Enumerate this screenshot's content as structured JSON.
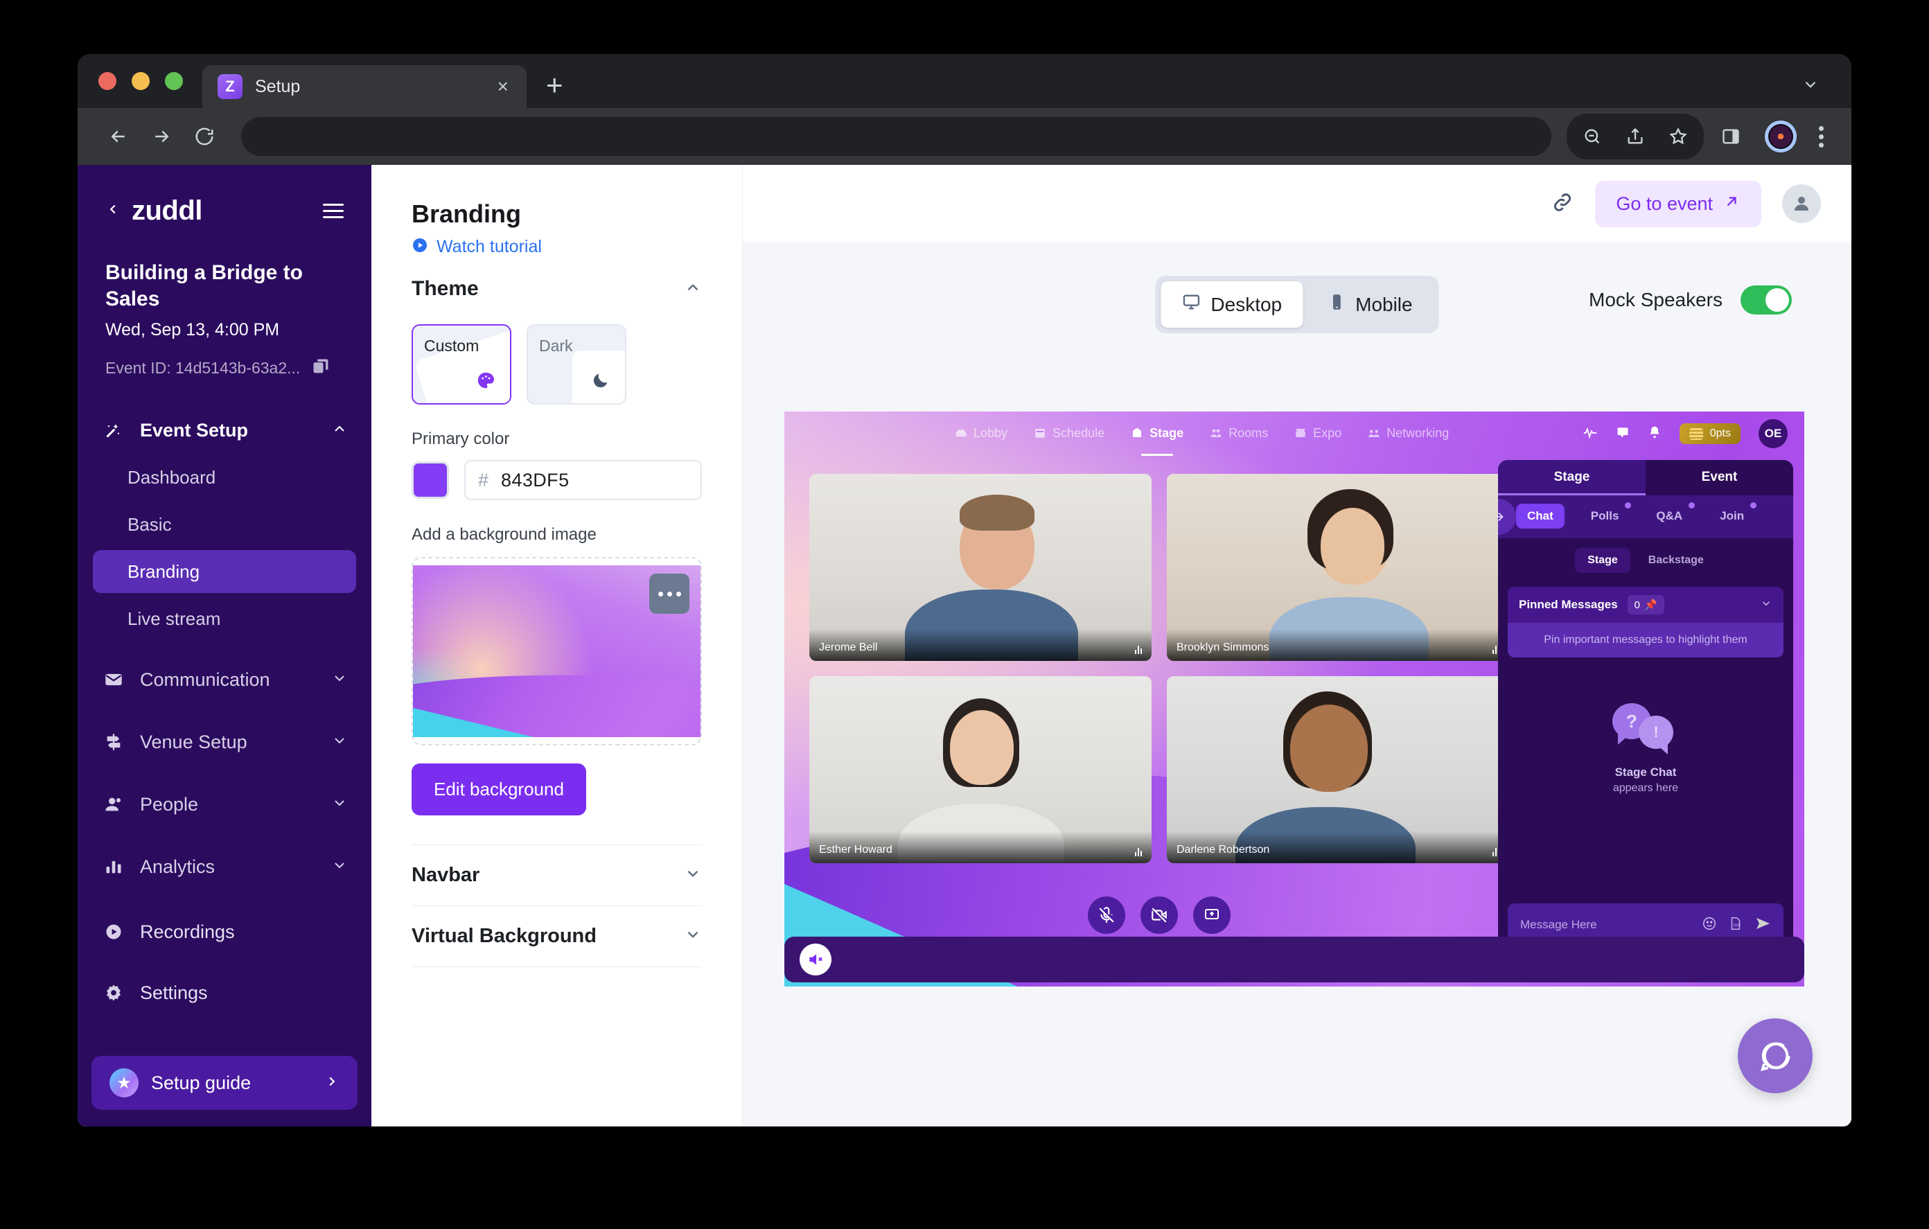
{
  "browser": {
    "tab": {
      "title": "Setup",
      "favicon_letter": "Z",
      "close_icon": "×"
    },
    "new_tab_label": "+",
    "window_chevron_icon": "chevron-down-icon",
    "toolbar_icons": [
      "back-icon",
      "forward-icon",
      "reload-icon",
      "zoom-out-icon",
      "share-icon",
      "bookmark-star-icon",
      "side-panel-icon",
      "profile-icon",
      "kebab-menu-icon"
    ],
    "address_value": ""
  },
  "sidebar": {
    "brand": "zuddl",
    "back_icon": "chevron-left-icon",
    "menu_icon": "hamburger-icon",
    "event_title": "Building a Bridge to Sales",
    "event_date": "Wed, Sep 13, 4:00 PM",
    "event_id": "Event ID: 14d5143b-63a2...",
    "copy_icon": "copy-icon",
    "groups": [
      {
        "label": "Event Setup",
        "icon": "magic-wand-icon",
        "expanded": true,
        "chevron": "chevron-up-icon",
        "children": [
          {
            "label": "Dashboard",
            "active": false
          },
          {
            "label": "Basic",
            "active": false
          },
          {
            "label": "Branding",
            "active": true
          },
          {
            "label": "Live stream",
            "active": false
          }
        ]
      },
      {
        "label": "Communication",
        "icon": "envelope-icon",
        "expanded": false,
        "chevron": "chevron-down-icon",
        "children": []
      },
      {
        "label": "Venue Setup",
        "icon": "signpost-icon",
        "expanded": false,
        "chevron": "chevron-down-icon",
        "children": []
      },
      {
        "label": "People",
        "icon": "person-icon",
        "expanded": false,
        "chevron": "chevron-down-icon",
        "children": []
      },
      {
        "label": "Analytics",
        "icon": "bar-chart-icon",
        "expanded": false,
        "chevron": "chevron-down-icon",
        "children": []
      }
    ],
    "items": [
      {
        "label": "Recordings",
        "icon": "play-circle-icon"
      },
      {
        "label": "Settings",
        "icon": "gear-icon"
      }
    ],
    "setup_guide": {
      "label": "Setup guide",
      "icon": "star-icon",
      "chevron": "chevron-right-icon"
    }
  },
  "header": {
    "title": "Branding",
    "tutorial_label": "Watch tutorial",
    "tutorial_icon": "play-circle-icon",
    "link_icon": "link-icon",
    "go_to_event_label": "Go to event",
    "go_to_event_icon": "arrow-up-right-icon",
    "avatar_icon": "person-icon"
  },
  "panel": {
    "theme": {
      "section_title": "Theme",
      "chevron": "chevron-up-icon",
      "options": [
        {
          "label": "Custom",
          "selected": true,
          "icon": "palette-icon"
        },
        {
          "label": "Dark",
          "selected": false,
          "icon": "moon-icon"
        }
      ],
      "primary_color_label": "Primary color",
      "primary_color_hash": "#",
      "primary_color_value": "843DF5",
      "primary_color_hex": "#843DF5"
    },
    "background": {
      "label": "Add a background image",
      "more_icon": "ellipsis-icon",
      "edit_button": "Edit background"
    },
    "accordions": [
      {
        "label": "Navbar",
        "chevron": "chevron-down-icon"
      },
      {
        "label": "Virtual Background",
        "chevron": "chevron-down-icon"
      }
    ]
  },
  "preview": {
    "device_tabs": [
      {
        "label": "Desktop",
        "icon": "monitor-icon",
        "active": true
      },
      {
        "label": "Mobile",
        "icon": "phone-icon",
        "active": false
      }
    ],
    "mock_speakers_label": "Mock Speakers",
    "mock_speakers_on": true,
    "event_nav": [
      {
        "label": "Lobby",
        "icon": "lobby-icon",
        "active": false
      },
      {
        "label": "Schedule",
        "icon": "schedule-icon",
        "active": false
      },
      {
        "label": "Stage",
        "icon": "stage-icon",
        "active": true
      },
      {
        "label": "Rooms",
        "icon": "rooms-icon",
        "active": false
      },
      {
        "label": "Expo",
        "icon": "expo-icon",
        "active": false
      },
      {
        "label": "Networking",
        "icon": "networking-icon",
        "active": false
      }
    ],
    "event_nav_right": {
      "icons": [
        "activity-icon",
        "chat-icon",
        "bell-icon"
      ],
      "points_label": "0pts",
      "points_icon": "coins-icon",
      "user_initials": "OE"
    },
    "speakers": [
      {
        "name": "Jerome Bell"
      },
      {
        "name": "Brooklyn Simmons"
      },
      {
        "name": "Esther Howard"
      },
      {
        "name": "Darlene Robertson"
      }
    ],
    "stage_controls": [
      {
        "icon": "mic-off-icon"
      },
      {
        "icon": "video-off-icon"
      },
      {
        "icon": "screen-share-icon"
      }
    ],
    "bottom_bar_icon": "speaker-mute-icon",
    "chat": {
      "collapse_icon": "arrow-right-icon",
      "top_tabs": [
        {
          "label": "Stage",
          "active": true
        },
        {
          "label": "Event",
          "active": false
        }
      ],
      "chips": [
        {
          "label": "Chat",
          "active": true,
          "dot": false
        },
        {
          "label": "Polls",
          "active": false,
          "dot": true
        },
        {
          "label": "Q&A",
          "active": false,
          "dot": true
        },
        {
          "label": "Join",
          "active": false,
          "dot": true
        }
      ],
      "scope_tabs": [
        {
          "label": "Stage",
          "active": true
        },
        {
          "label": "Backstage",
          "active": false
        }
      ],
      "pinned_title": "Pinned Messages",
      "pinned_count": "0",
      "pin_icon": "pin-icon",
      "pinned_chevron": "chevron-down-icon",
      "pinned_empty": "Pin important messages to highlight them",
      "empty_title": "Stage Chat",
      "empty_subtitle": "appears here",
      "empty_icon": "chat-bubbles-icon",
      "input_placeholder": "Message Here",
      "input_icons": [
        "emoji-icon",
        "gif-icon",
        "send-icon"
      ]
    },
    "help_bubble_icon": "chat-support-icon"
  }
}
